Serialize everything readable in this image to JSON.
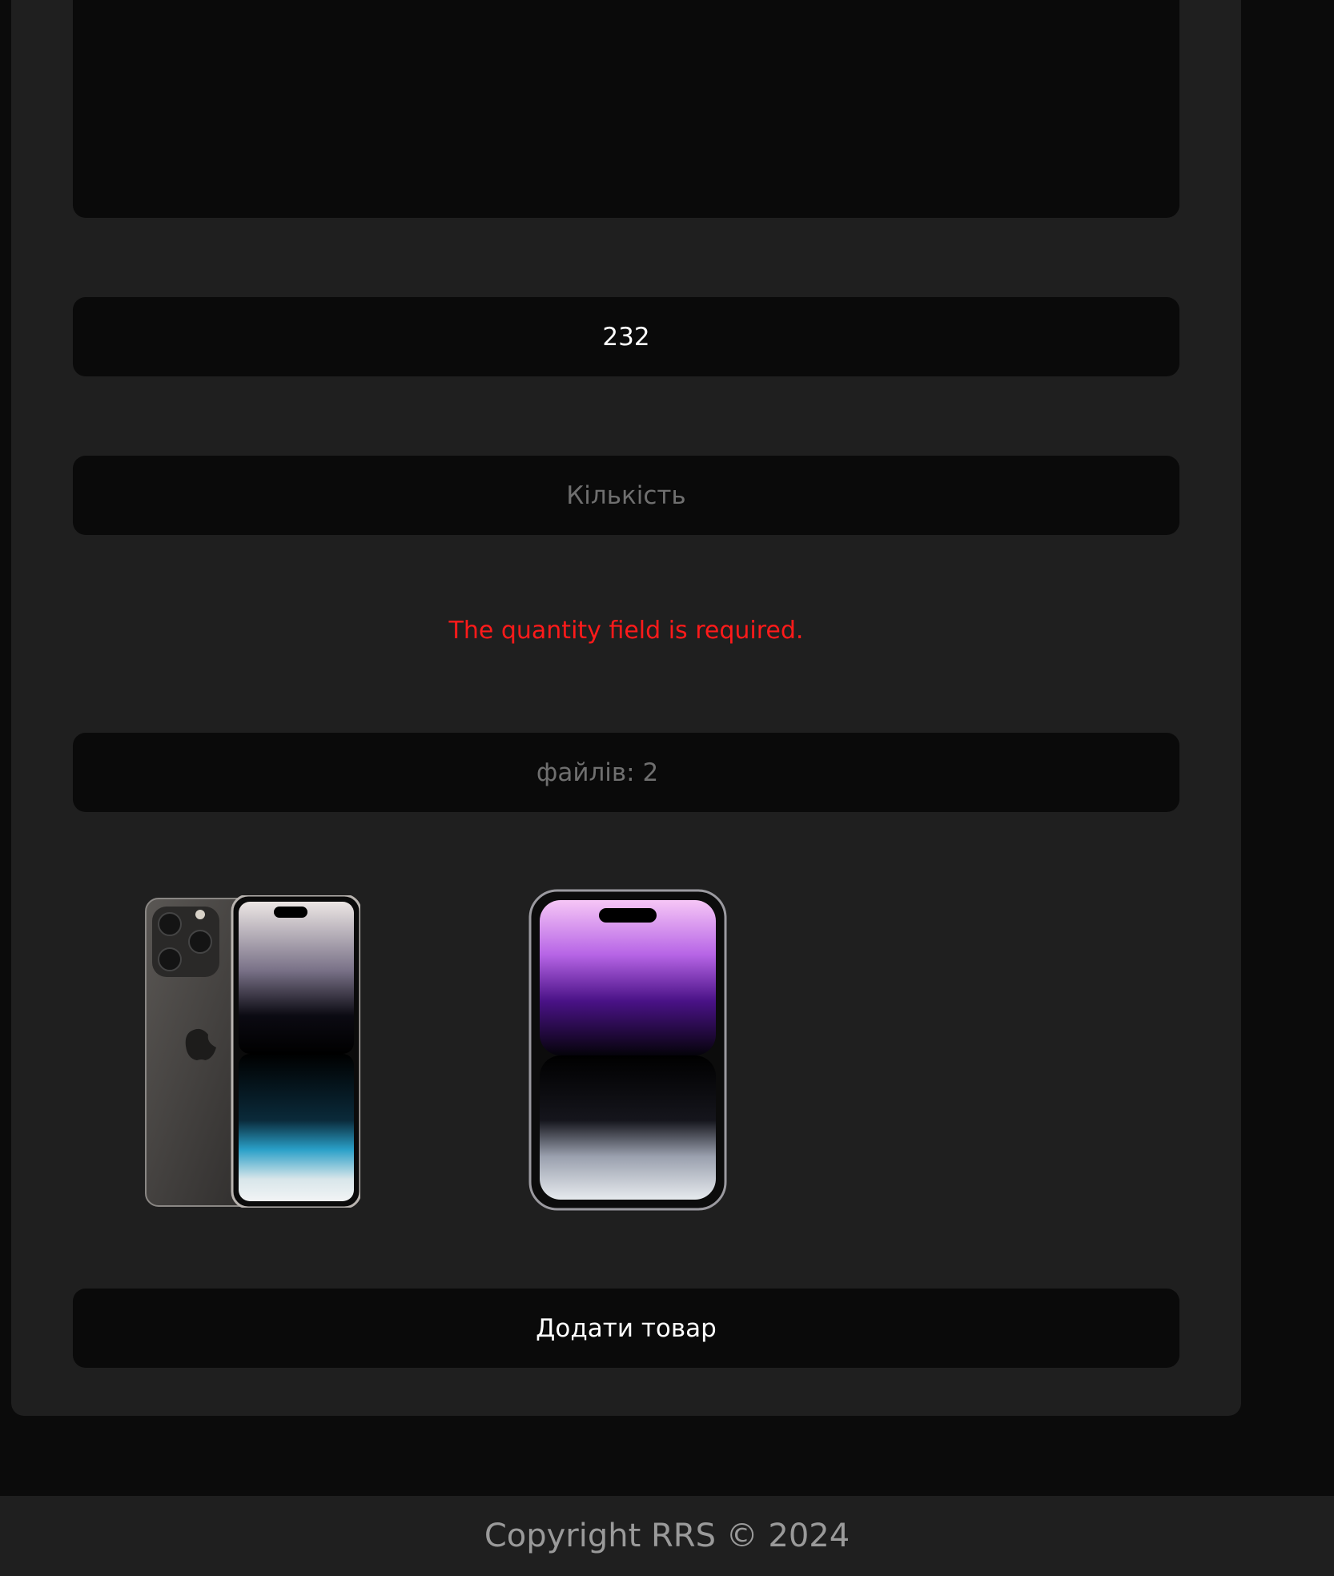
{
  "form": {
    "price_value": "232",
    "quantity_placeholder": "Кількість",
    "quantity_error": "The quantity field is required.",
    "files_label": "файлів: 2",
    "submit_label": "Додати товар"
  },
  "previews": [
    {
      "name": "phone-back-front-preview"
    },
    {
      "name": "phone-front-preview"
    }
  ],
  "footer": {
    "copyright": "Copyright RRS © 2024"
  },
  "colors": {
    "background": "#0b0b0b",
    "card": "#1f1f1f",
    "field": "#0a0a0a",
    "error": "#ff1a1a"
  }
}
